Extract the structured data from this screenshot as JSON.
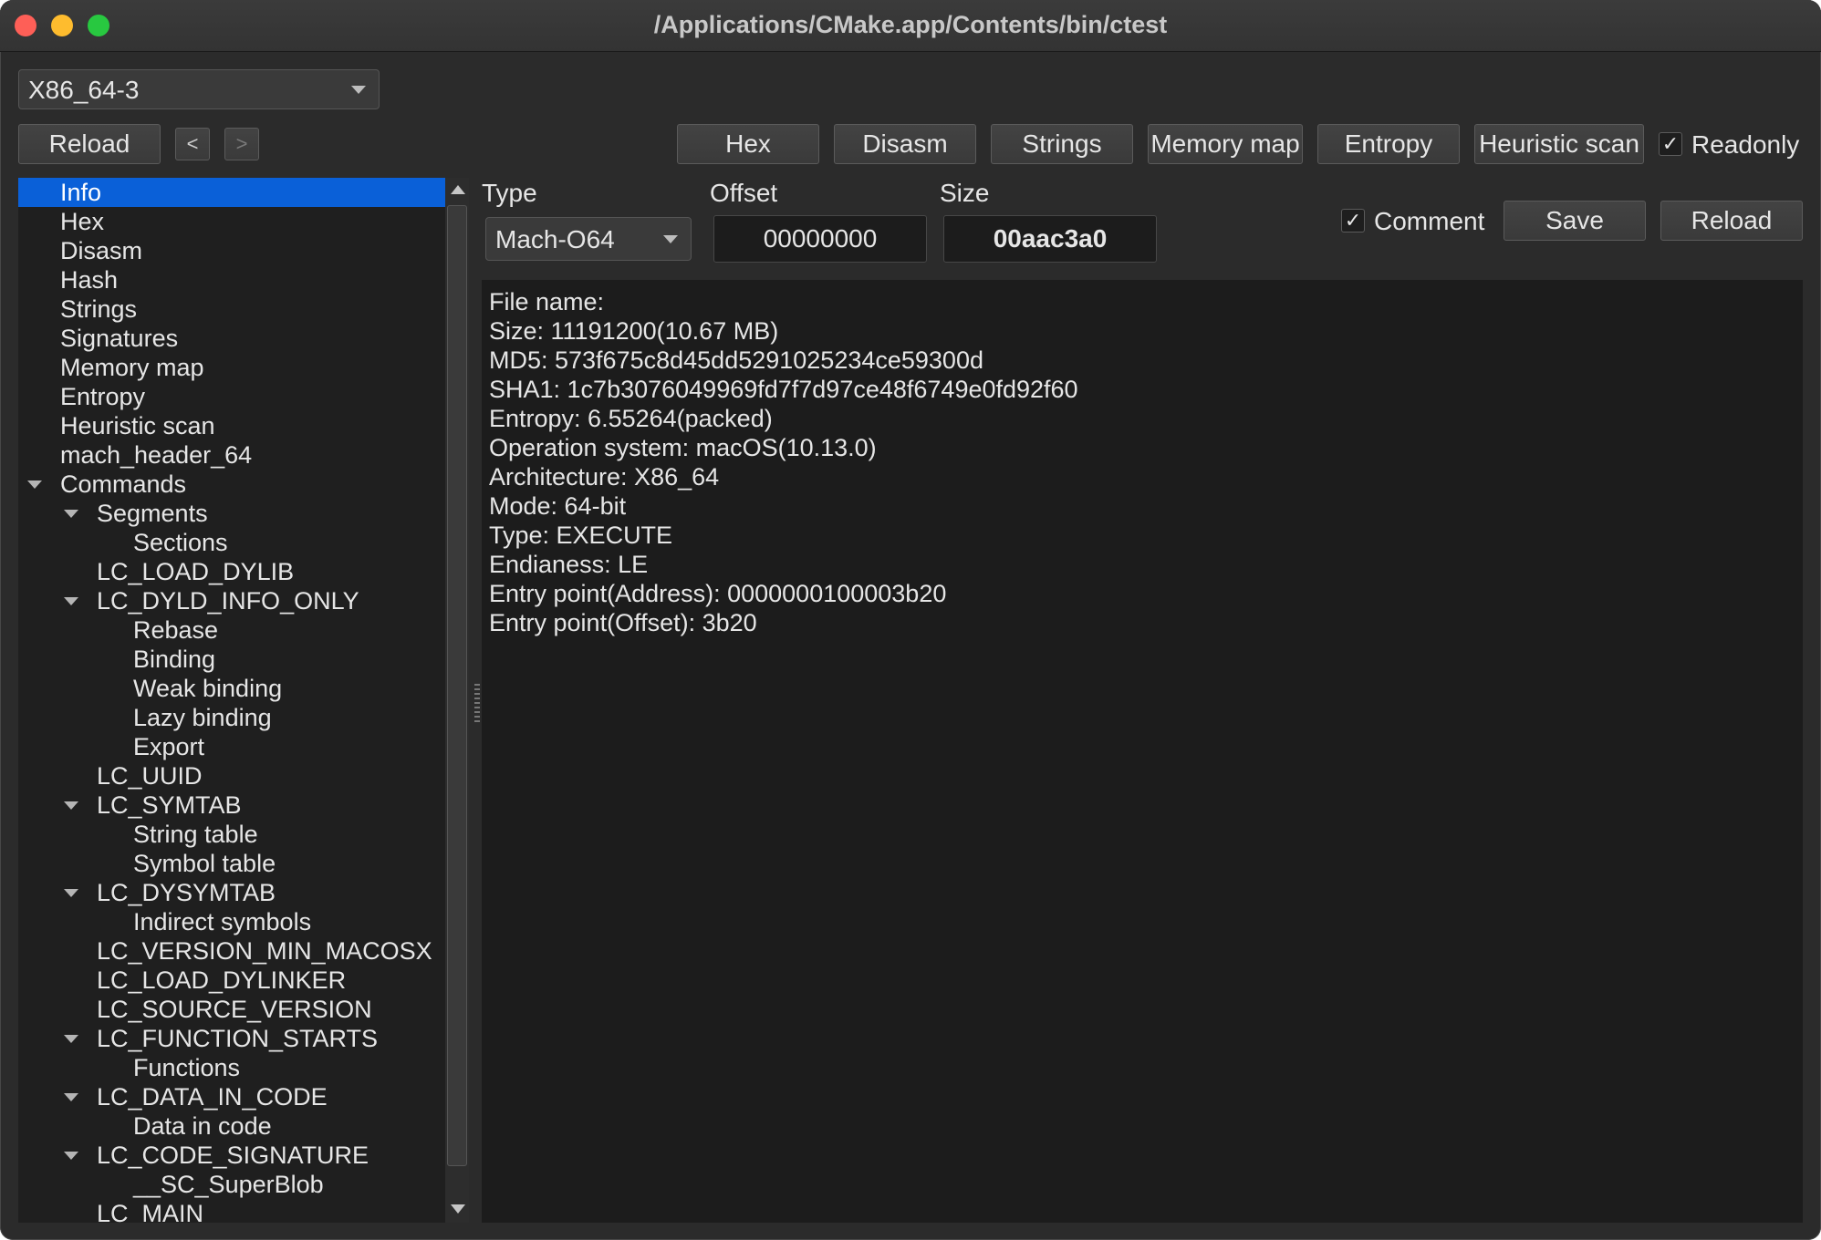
{
  "window": {
    "title": "/Applications/CMake.app/Contents/bin/ctest"
  },
  "arch_select": {
    "value": "X86_64-3"
  },
  "toolbar": {
    "reload_label": "Reload",
    "back_label": "<",
    "forward_label": ">",
    "hex_label": "Hex",
    "disasm_label": "Disasm",
    "strings_label": "Strings",
    "memory_map_label": "Memory map",
    "entropy_label": "Entropy",
    "heuristic_scan_label": "Heuristic scan",
    "readonly_label": "Readonly",
    "readonly_checked": true
  },
  "tree": {
    "items": [
      {
        "label": "Info",
        "selected": true
      },
      {
        "label": "Hex"
      },
      {
        "label": "Disasm"
      },
      {
        "label": "Hash"
      },
      {
        "label": "Strings"
      },
      {
        "label": "Signatures"
      },
      {
        "label": "Memory map"
      },
      {
        "label": "Entropy"
      },
      {
        "label": "Heuristic scan"
      },
      {
        "label": "mach_header_64"
      },
      {
        "label": "Commands",
        "expanded": true
      },
      {
        "label": "Segments",
        "expanded": true
      },
      {
        "label": "Sections"
      },
      {
        "label": "LC_LOAD_DYLIB"
      },
      {
        "label": "LC_DYLD_INFO_ONLY",
        "expanded": true
      },
      {
        "label": "Rebase"
      },
      {
        "label": "Binding"
      },
      {
        "label": "Weak binding"
      },
      {
        "label": "Lazy binding"
      },
      {
        "label": "Export"
      },
      {
        "label": "LC_UUID"
      },
      {
        "label": "LC_SYMTAB",
        "expanded": true
      },
      {
        "label": "String table"
      },
      {
        "label": "Symbol table"
      },
      {
        "label": "LC_DYSYMTAB",
        "expanded": true
      },
      {
        "label": "Indirect symbols"
      },
      {
        "label": "LC_VERSION_MIN_MACOSX"
      },
      {
        "label": "LC_LOAD_DYLINKER"
      },
      {
        "label": "LC_SOURCE_VERSION"
      },
      {
        "label": "LC_FUNCTION_STARTS",
        "expanded": true
      },
      {
        "label": "Functions"
      },
      {
        "label": "LC_DATA_IN_CODE",
        "expanded": true
      },
      {
        "label": "Data in code"
      },
      {
        "label": "LC_CODE_SIGNATURE",
        "expanded": true
      },
      {
        "label": "__SC_SuperBlob"
      },
      {
        "label": "LC_MAIN"
      }
    ]
  },
  "info_panel": {
    "type_label": "Type",
    "offset_label": "Offset",
    "size_label": "Size",
    "type_value": "Mach-O64",
    "offset_value": "00000000",
    "size_value": "00aac3a0",
    "comment_label": "Comment",
    "comment_checked": true,
    "save_label": "Save",
    "reload_label": "Reload",
    "lines": [
      "File name:",
      "Size: 11191200(10.67 MB)",
      "MD5: 573f675c8d45dd5291025234ce59300d",
      "SHA1: 1c7b3076049969fd7f7d97ce48f6749e0fd92f60",
      "Entropy: 6.55264(packed)",
      "Operation system: macOS(10.13.0)",
      "Architecture: X86_64",
      "Mode: 64-bit",
      "Type: EXECUTE",
      "Endianess: LE",
      "Entry point(Address): 0000000100003b20",
      "Entry point(Offset): 3b20"
    ]
  }
}
